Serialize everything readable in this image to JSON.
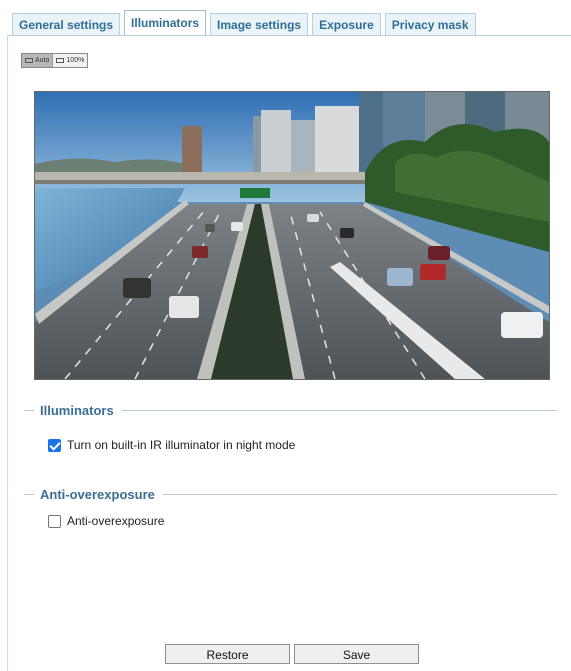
{
  "tabs": [
    {
      "label": "General settings",
      "active": false
    },
    {
      "label": "Illuminators",
      "active": true
    },
    {
      "label": "Image settings",
      "active": false
    },
    {
      "label": "Exposure",
      "active": false
    },
    {
      "label": "Privacy mask",
      "active": false
    }
  ],
  "view_size": {
    "auto_label": "Auto",
    "full_label": "100%"
  },
  "illuminators": {
    "title": "Illuminators",
    "ir_label": "Turn on built-in IR illuminator in night mode",
    "ir_checked": true
  },
  "anti_overexposure": {
    "title": "Anti-overexposure",
    "label": "Anti-overexposure",
    "checked": false
  },
  "buttons": {
    "restore_label": "Restore",
    "save_label": "Save"
  },
  "colors": {
    "accent": "#3b6e95",
    "tab_bg": "#e9f3f8",
    "checkbox_on": "#1a73e8"
  }
}
